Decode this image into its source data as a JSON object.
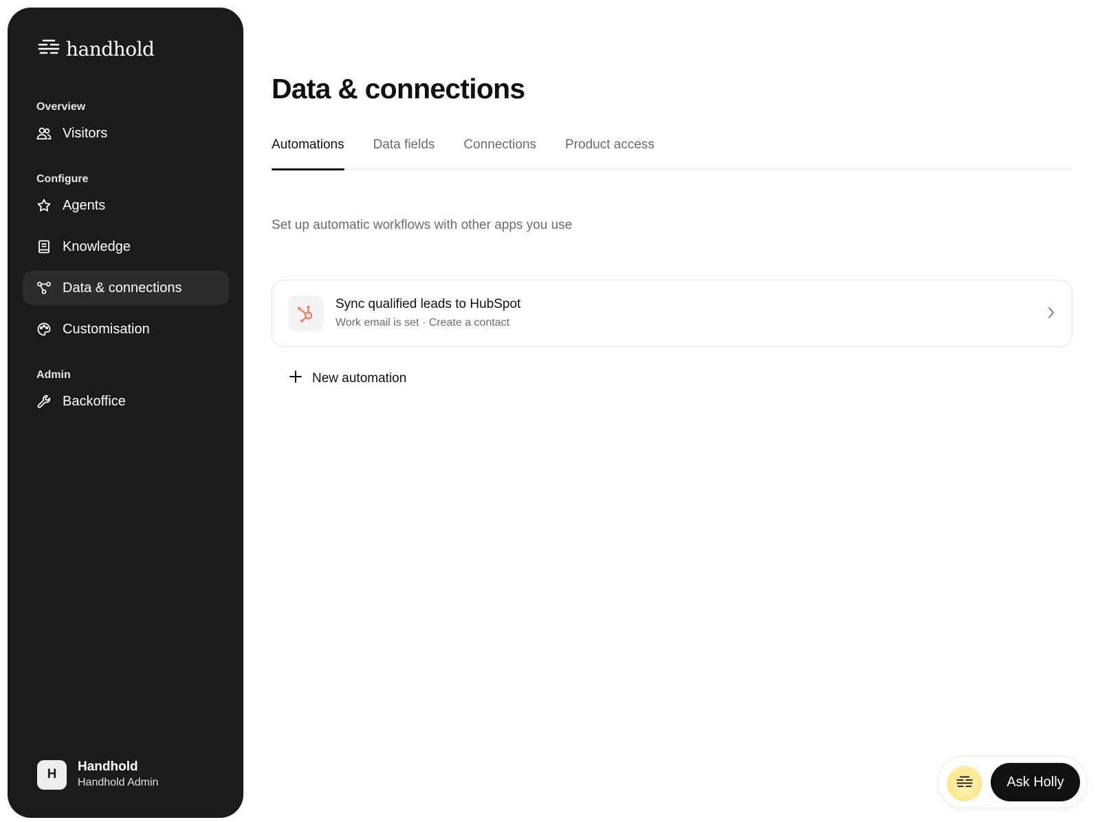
{
  "sidebar": {
    "brand": "handhold",
    "sections": {
      "overview": "Overview",
      "configure": "Configure",
      "admin": "Admin"
    },
    "items": [
      {
        "label": "Visitors",
        "icon": "users-icon"
      },
      {
        "label": "Agents",
        "icon": "star-icon"
      },
      {
        "label": "Knowledge",
        "icon": "book-icon"
      },
      {
        "label": "Data & connections",
        "icon": "connections-icon",
        "active": true
      },
      {
        "label": "Customisation",
        "icon": "palette-icon"
      },
      {
        "label": "Backoffice",
        "icon": "wrench-icon"
      }
    ],
    "user": {
      "initial": "H",
      "name": "Handhold",
      "role": "Handhold Admin"
    }
  },
  "main": {
    "title": "Data & connections",
    "tabs": [
      {
        "label": "Automations",
        "active": true
      },
      {
        "label": "Data fields"
      },
      {
        "label": "Connections"
      },
      {
        "label": "Product access"
      }
    ],
    "subtitle": "Set up automatic workflows with other apps you use",
    "automations": [
      {
        "title": "Sync qualified leads to HubSpot",
        "subtitle": "Work email is set · Create a contact",
        "icon": "hubspot-icon"
      }
    ],
    "new_automation_label": "New automation"
  },
  "assistant": {
    "button_label": "Ask Holly"
  },
  "colors": {
    "sidebar_bg": "#1b1b1c",
    "active_item_bg": "#2c2c2e",
    "hubspot_orange": "#ff7a59",
    "text_primary": "#111111",
    "text_secondary": "#6b6b6b"
  }
}
